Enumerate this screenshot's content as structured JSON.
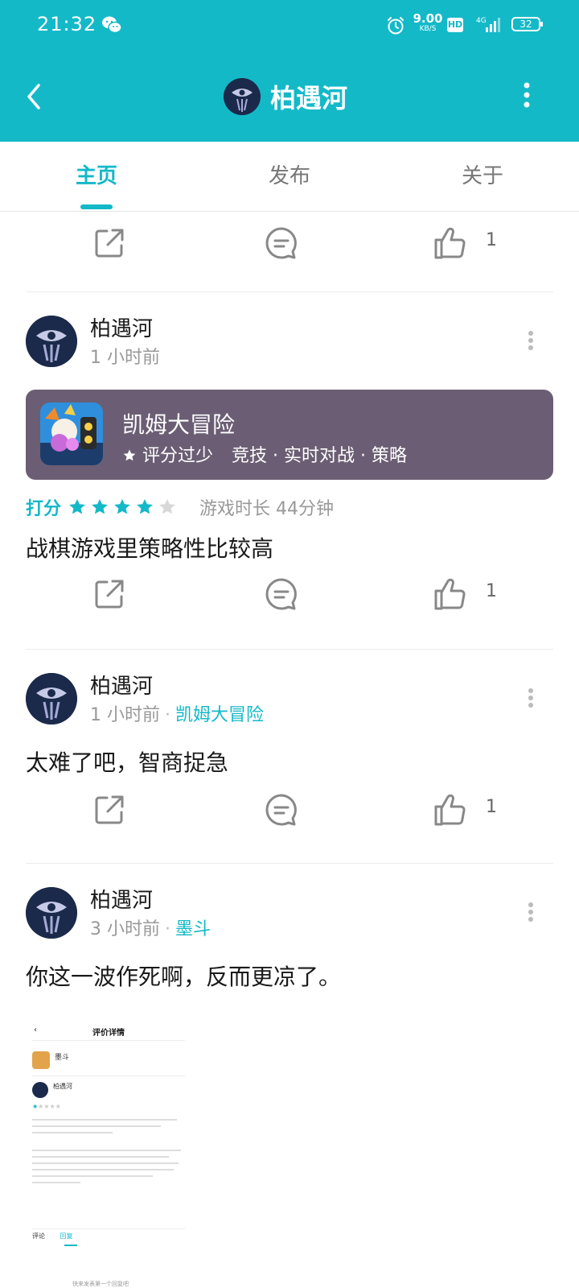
{
  "status_bar": {
    "time": "21:32",
    "net_speed": "9.00",
    "net_unit": "KB/S",
    "hd": "HD",
    "network": "4G",
    "battery": "32"
  },
  "header": {
    "title": "柏遇河"
  },
  "tabs": [
    {
      "label": "主页"
    },
    {
      "label": "发布"
    },
    {
      "label": "关于"
    }
  ],
  "top_actions": {
    "like_count": "1"
  },
  "posts": [
    {
      "username": "柏遇河",
      "time": "1 小时前",
      "game_card": {
        "name": "凯姆大冒险",
        "rating_text": "评分过少",
        "tags": "竞技 · 实时对战 · 策略"
      },
      "rating_label": "打分",
      "stars": 4,
      "stars_max": 5,
      "play_time": "游戏时长 44分钟",
      "content": "战棋游戏里策略性比较高",
      "like_count": "1"
    },
    {
      "username": "柏遇河",
      "time": "1 小时前",
      "separator": "·",
      "game": "凯姆大冒险",
      "content": "太难了吧，智商捉急",
      "like_count": "1"
    },
    {
      "username": "柏遇河",
      "time": "3 小时前",
      "separator": "·",
      "game": "墨斗",
      "content": "你这一波作死啊，反而更凉了。",
      "screenshot": {
        "title": "评价详情",
        "game": "墨斗",
        "user": "柏遇河",
        "tab_a": "评论",
        "tab_b": "回复",
        "hint": "快来发表第一个回复吧"
      }
    }
  ],
  "colors": {
    "accent": "#14b9c8",
    "card_bg": "#6b5e74"
  },
  "icons": [
    "back-arrow-icon",
    "more-icon",
    "share-icon",
    "comment-icon",
    "thumbs-up-icon",
    "star-icon"
  ]
}
